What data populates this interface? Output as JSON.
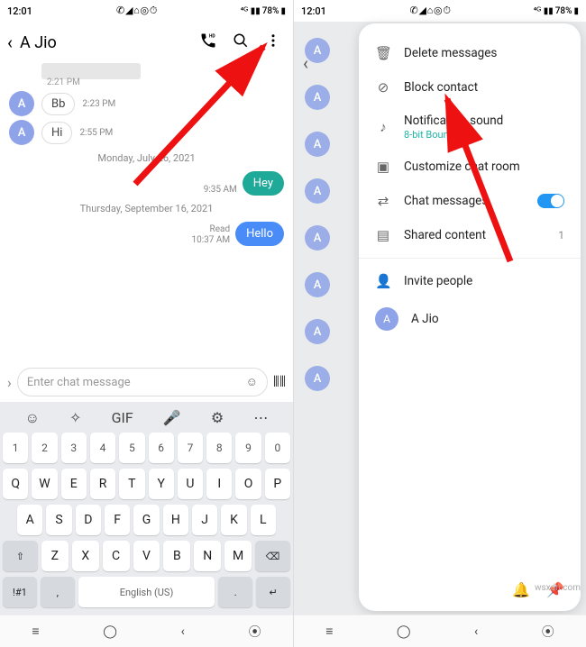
{
  "status": {
    "time": "12:01",
    "icons_left": "✆ ◢ ⌂ ◎ ⏱",
    "signal": "⁴ᴳ ▮▮",
    "battery": "78%",
    "batt_icon": "▮"
  },
  "left": {
    "header": {
      "title": "A Jio"
    },
    "redacted_time": "2:21 PM",
    "rows": [
      {
        "avatar": "A",
        "text": "Bb",
        "time": "2:23 PM"
      },
      {
        "avatar": "A",
        "text": "Hi",
        "time": "2:55 PM"
      }
    ],
    "date1": "Monday, July 26, 2021",
    "out1": {
      "text": "Hey",
      "time": "9:35 AM"
    },
    "date2": "Thursday, September 16, 2021",
    "out2": {
      "text": "Hello",
      "status": "Read",
      "time": "10:37 AM"
    },
    "input_placeholder": "Enter chat message",
    "keyboard": {
      "nums": [
        "1",
        "2",
        "3",
        "4",
        "5",
        "6",
        "7",
        "8",
        "9",
        "0"
      ],
      "r1": [
        "Q",
        "W",
        "E",
        "R",
        "T",
        "Y",
        "U",
        "I",
        "O",
        "P"
      ],
      "r2": [
        "A",
        "S",
        "D",
        "F",
        "G",
        "H",
        "J",
        "K",
        "L"
      ],
      "r3": [
        "⇧",
        "Z",
        "X",
        "C",
        "V",
        "B",
        "N",
        "M",
        "⌫"
      ],
      "r4_sym": "!#1",
      "r4_comma": ",",
      "space": "English (US)",
      "r4_dot": ".",
      "r4_enter": "↵"
    }
  },
  "right": {
    "menu": [
      {
        "icon": "🗑",
        "label": "Delete messages"
      },
      {
        "icon": "⊘",
        "label": "Block contact"
      },
      {
        "icon": "♪",
        "label": "Notification sound",
        "sub": "8-bit Bounce"
      },
      {
        "icon": "▣",
        "label": "Customize chat room"
      },
      {
        "icon": "⇄",
        "label": "Chat messages",
        "toggle": true
      },
      {
        "icon": "▤",
        "label": "Shared content",
        "count": "1"
      }
    ],
    "invite": {
      "icon": "👤",
      "label": "Invite people"
    },
    "contact": {
      "initial": "A",
      "name": "A Jio"
    }
  },
  "watermark": "wsxdn.com"
}
